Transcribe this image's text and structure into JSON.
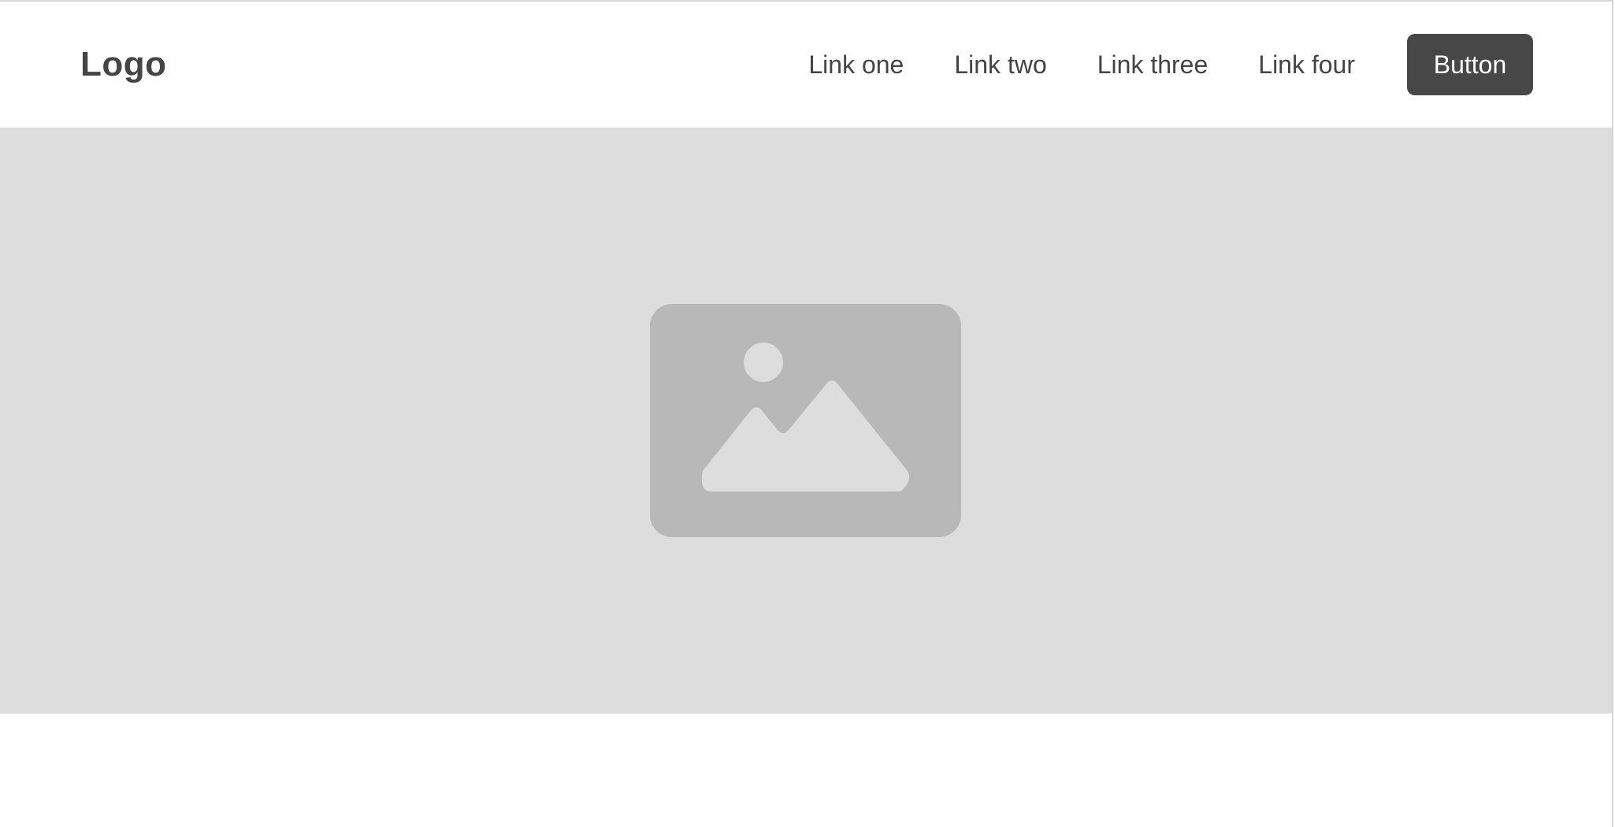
{
  "navbar": {
    "logo": "Logo",
    "links": [
      "Link one",
      "Link two",
      "Link three",
      "Link four"
    ],
    "button_label": "Button"
  },
  "hero": {
    "icon": "image-placeholder-icon"
  },
  "colors": {
    "text": "#444444",
    "button_bg": "#474747",
    "button_text": "#ffffff",
    "hero_bg": "#dddddd",
    "icon_fill": "#b8b8b8"
  }
}
